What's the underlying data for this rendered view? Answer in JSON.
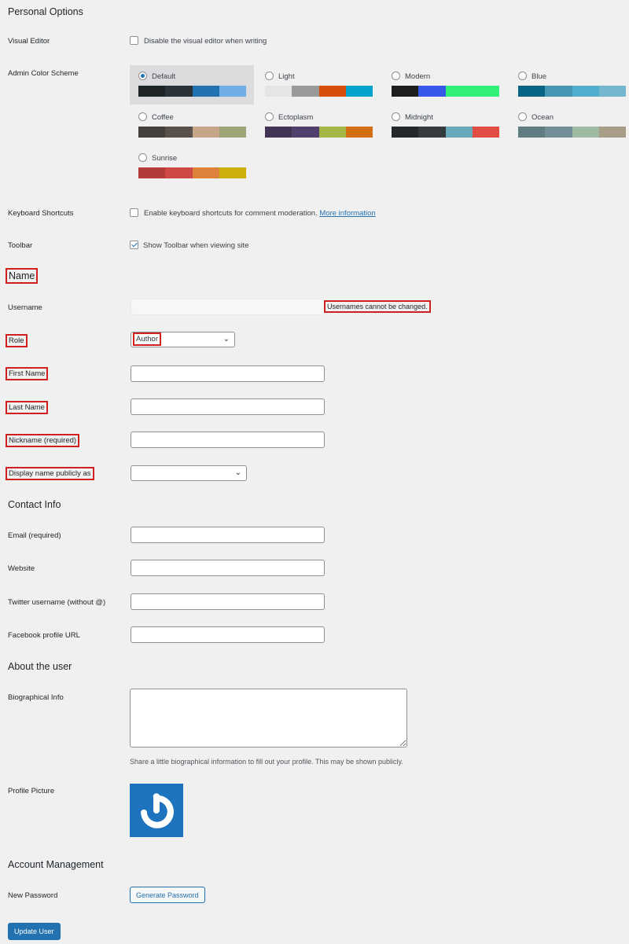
{
  "personal_options": {
    "heading": "Personal Options",
    "visual_editor": {
      "label": "Visual Editor",
      "checkbox_text": "Disable the visual editor when writing",
      "checked": false
    },
    "admin_color_scheme": {
      "label": "Admin Color Scheme",
      "selected": "Default",
      "schemes": [
        {
          "name": "Default",
          "colors": [
            "#1d2327",
            "#2c3338",
            "#2271b1",
            "#72aee6"
          ]
        },
        {
          "name": "Light",
          "colors": [
            "#e5e5e5",
            "#999999",
            "#d64e07",
            "#04a4cc"
          ]
        },
        {
          "name": "Modern",
          "colors": [
            "#1e1e1e",
            "#3858e9",
            "#33f078",
            "#33f078"
          ]
        },
        {
          "name": "Blue",
          "colors": [
            "#096484",
            "#4796b3",
            "#52accc",
            "#74B6CE"
          ]
        },
        {
          "name": "Coffee",
          "colors": [
            "#46403c",
            "#59524c",
            "#c7a589",
            "#9ea476"
          ]
        },
        {
          "name": "Ectoplasm",
          "colors": [
            "#413256",
            "#523f6d",
            "#a3b745",
            "#d46f15"
          ]
        },
        {
          "name": "Midnight",
          "colors": [
            "#25282b",
            "#363b3f",
            "#69a8bb",
            "#e14d43"
          ]
        },
        {
          "name": "Ocean",
          "colors": [
            "#627c83",
            "#738e96",
            "#9ebaa0",
            "#aa9d88"
          ]
        },
        {
          "name": "Sunrise",
          "colors": [
            "#b43c38",
            "#cf4944",
            "#dd823b",
            "#ccaf0b"
          ]
        }
      ]
    },
    "keyboard_shortcuts": {
      "label": "Keyboard Shortcuts",
      "checkbox_text": "Enable keyboard shortcuts for comment moderation.",
      "link_text": "More information",
      "checked": false
    },
    "toolbar": {
      "label": "Toolbar",
      "checkbox_text": "Show Toolbar when viewing site",
      "checked": true
    }
  },
  "name_section": {
    "heading": "Name",
    "username": {
      "label": "Username",
      "value": "",
      "note": "Usernames cannot be changed."
    },
    "role": {
      "label": "Role",
      "value": "Author"
    },
    "first_name": {
      "label": "First Name",
      "value": ""
    },
    "last_name": {
      "label": "Last Name",
      "value": ""
    },
    "nickname": {
      "label": "Nickname (required)",
      "value": ""
    },
    "display_name": {
      "label": "Display name publicly as",
      "value": ""
    }
  },
  "contact_info": {
    "heading": "Contact Info",
    "email": {
      "label": "Email (required)",
      "value": ""
    },
    "website": {
      "label": "Website",
      "value": ""
    },
    "twitter": {
      "label": "Twitter username (without @)",
      "value": ""
    },
    "facebook": {
      "label": "Facebook profile URL",
      "value": ""
    }
  },
  "about": {
    "heading": "About the user",
    "bio": {
      "label": "Biographical Info",
      "value": "",
      "description": "Share a little biographical information to fill out your profile. This may be shown publicly."
    },
    "profile_picture": {
      "label": "Profile Picture",
      "icon": "gravatar-logo-icon"
    }
  },
  "account": {
    "heading": "Account Management",
    "new_password": {
      "label": "New Password",
      "button": "Generate Password"
    },
    "update_button": "Update User"
  },
  "colors": {
    "accent": "#2271b1",
    "highlight": "#d01f1f",
    "background": "#f0f0f1"
  }
}
